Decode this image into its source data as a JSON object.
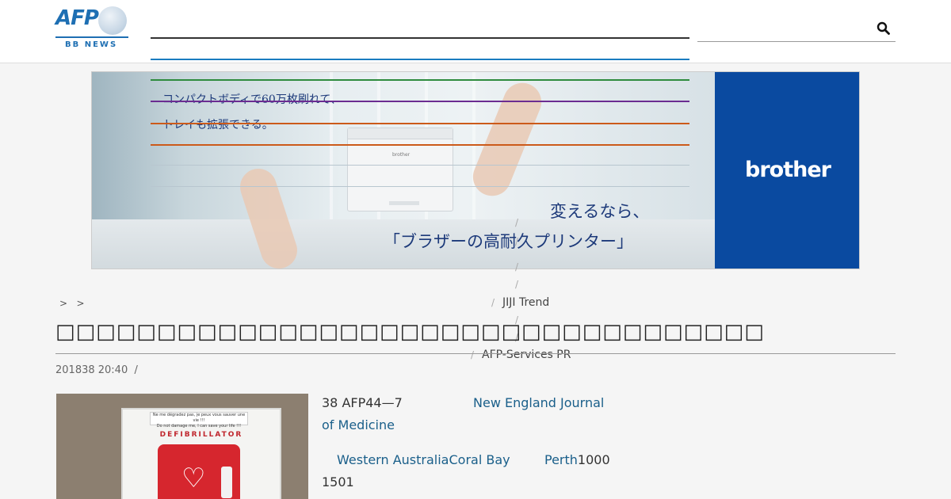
{
  "header": {
    "logo_text": "AFP",
    "logo_sub": "BB NEWS",
    "search_placeholder": "",
    "search_icon": "search-icon"
  },
  "ad": {
    "copy_line1": "コンパクトボディで60万枚刷れて、",
    "copy_line2": "トレイも拡張できる。",
    "tagline_line1": "変えるなら、",
    "tagline_line2": "「ブラザーの高耐久プリンター」",
    "printer_label": "brother",
    "brand": "brother",
    "brand_color": "#0a4aa0"
  },
  "breadcrumb": {
    "separator1": ">",
    "separator2": ">"
  },
  "menu": {
    "item1": "JIJI Trend",
    "item2": "AFP-Services PR",
    "slash": "/"
  },
  "article": {
    "title": "□□□□□□□□□□□□□□□□□□□□□□□□□□□□□□□□□□□",
    "meta_date": "201838 20:40",
    "meta_sep": "/",
    "image": {
      "sign_line1": "Ne me dégradez pas, je peux vous sauver une vie !!!",
      "sign_line2": "Do not damage me, I can save your life !!!",
      "label": "DEFIBRILLATOR"
    },
    "para1_prefix": "38 AFP44—7",
    "para1_link_a": "New England Journal",
    "para1_link_b": "of Medicine",
    "para2_link_a": "Western AustraliaCoral Bay",
    "para2_link_b": "Perth",
    "para2_suffix": "1000",
    "para3": "1501"
  }
}
